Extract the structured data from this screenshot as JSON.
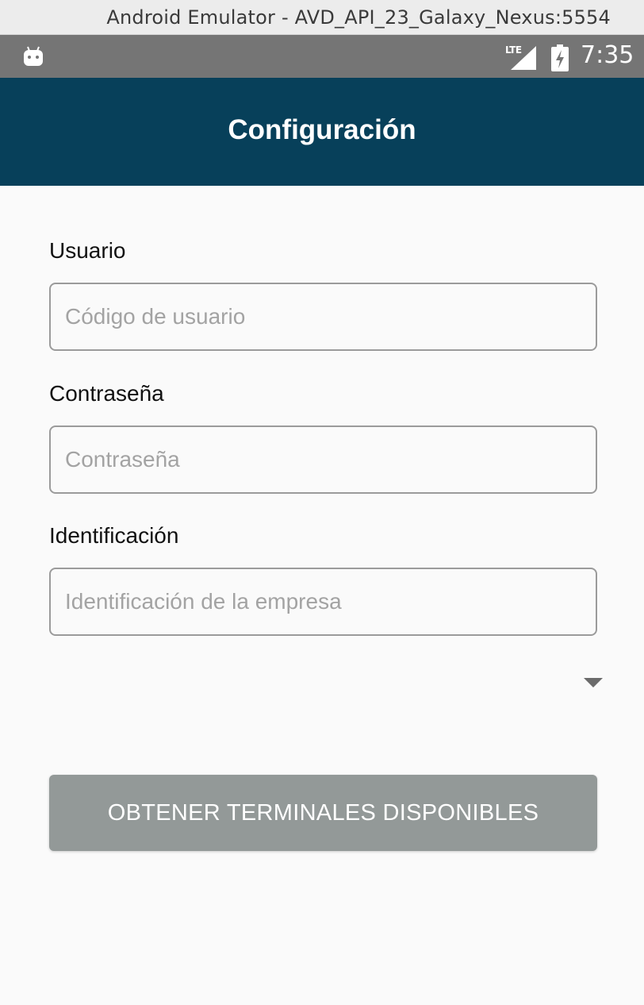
{
  "window": {
    "title": "Android Emulator - AVD_API_23_Galaxy_Nexus:5554"
  },
  "status_bar": {
    "network": "LTE",
    "time": "7:35",
    "notification_icon": "android-icon",
    "battery_icon": "battery-charging-icon"
  },
  "app_bar": {
    "title": "Configuración",
    "color": "#07405a"
  },
  "form": {
    "user": {
      "label": "Usuario",
      "placeholder": "Código de usuario",
      "value": ""
    },
    "password": {
      "label": "Contraseña",
      "placeholder": "Contraseña",
      "value": ""
    },
    "company": {
      "label": "Identificación",
      "placeholder": "Identificación de la empresa",
      "value": ""
    },
    "terminal_select": {
      "selected": "",
      "icon": "chevron-down-icon"
    },
    "submit_label": "OBTENER TERMINALES DISPONIBLES"
  }
}
